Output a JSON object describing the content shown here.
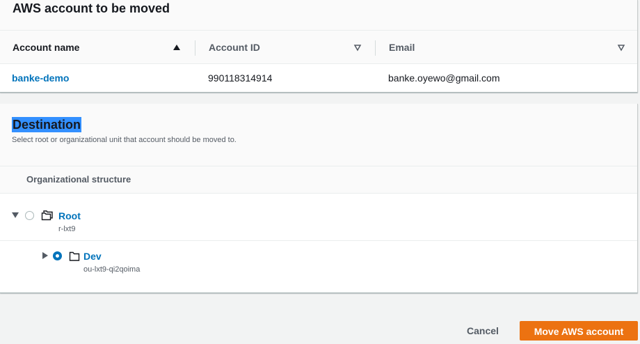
{
  "account_panel": {
    "title": "AWS account to be moved",
    "columns": [
      "Account name",
      "Account ID",
      "Email"
    ],
    "row": {
      "name": "banke-demo",
      "id": "990118314914",
      "email": "banke.oyewo@gmail.com"
    }
  },
  "destination": {
    "title": "Destination",
    "description": "Select root or organizational unit that account should be moved to.",
    "structure_header": "Organizational structure",
    "nodes": [
      {
        "name": "Root",
        "id": "r-lxt9",
        "expanded": true,
        "selected": false
      },
      {
        "name": "Dev",
        "id": "ou-lxt9-qi2qoima",
        "expanded": false,
        "selected": true
      }
    ]
  },
  "footer": {
    "cancel_label": "Cancel",
    "submit_label": "Move AWS account"
  },
  "colors": {
    "link": "#0073bb",
    "primary": "#ec7211",
    "selection": "#3390ff"
  }
}
